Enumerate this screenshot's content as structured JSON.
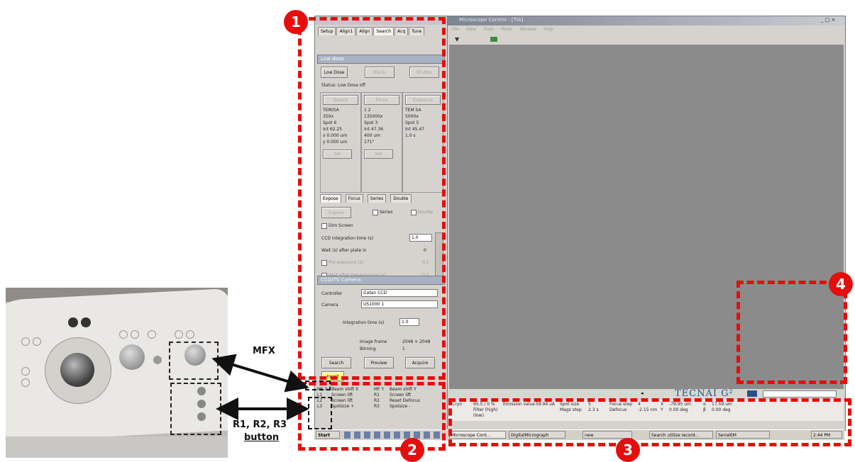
{
  "left_window": {
    "tabs": [
      "Setup",
      "Align1",
      "Align",
      "Search",
      "Acq",
      "Tune"
    ],
    "low_dose_panel": {
      "title": "Low dose",
      "buttons": [
        "Low Dose",
        "Blank",
        "Shutter"
      ],
      "status": "Status: Low Dose off",
      "columns": [
        {
          "label": "Search",
          "lines": [
            "TEM/SA",
            "350x",
            "Spot 6",
            "Int 62.25",
            "x 0.000 um",
            "y 0.000 um"
          ],
          "button": "Set"
        },
        {
          "label": "Focus",
          "lines": [
            "1 2",
            "135000x",
            "Spot 3",
            "Int 47.36",
            "400 um",
            "171°"
          ],
          "button": "Set"
        },
        {
          "label": "Exposure",
          "lines": [
            "TEM SA",
            "5000x",
            "Spot 5",
            "Int 45.47",
            "",
            "1.0 s"
          ],
          "button": ""
        }
      ],
      "tabs2": [
        "Expose",
        "Focus",
        "Series",
        "Double"
      ],
      "expose_button": "Expose",
      "series_label": "Series",
      "double_label": "Double",
      "dim_screen": "Dim Screen",
      "ccd_time_label": "CCD integration time (s)",
      "ccd_time_value": "1.0",
      "wait_label": "Wait (s) after plate in",
      "wait_value": "0",
      "pre_exposure": "Pre-exposure (s)",
      "pre_value": "0.1",
      "wait_after": "Wait after pre-exposure (s)",
      "wait_after_value": "0.1"
    },
    "ccd_panel": {
      "title": "CCD/TV Camera",
      "controller_label": "Controller",
      "controller_value": "Gatan CCD",
      "camera_label": "Camera",
      "camera_value": "US1000 1",
      "integration_label": "Integration time (s)",
      "integration_value": "1.0",
      "image_frame_label": "Image frame",
      "image_frame_value": "2048 × 2048",
      "binning_label": "Binning",
      "binning_value": "1",
      "buttons": [
        "Search",
        "Preview",
        "Acquire"
      ],
      "insert": "Insert"
    },
    "mf_rows": [
      [
        "MF X",
        "Beam shift X",
        "MF Y",
        "Beam shift Y"
      ],
      [
        "L1",
        "Screen lift",
        "R1",
        "Screen lift"
      ],
      [
        "L2",
        "Screen lift",
        "R2",
        "Reset Defocus"
      ],
      [
        "L3",
        "Spotsize +",
        "R3",
        "Spotsize -"
      ]
    ]
  },
  "main_window": {
    "title": "Microscope Control - [TIA]",
    "menu": [
      "File",
      "View",
      "Tools",
      "Mode",
      "Window",
      "Help"
    ],
    "logo": "TECNAI G²",
    "readouts": [
      [
        "Cryo",
        "95.5 / 0 %",
        "Emission value",
        "59.94 uA",
        "Spot size",
        "5",
        "Focus step",
        "4",
        "X",
        "-79.95 um",
        "α",
        "17.59 um"
      ],
      [
        "",
        "Filter (high) (low)",
        "",
        "",
        "Mags step",
        "2.3 s",
        "Defocus",
        "-2.15 nm",
        "Y",
        "0.00 deg",
        "β",
        "0.00 deg"
      ]
    ]
  },
  "taskbar": {
    "start": "Start",
    "items": [
      "Microscope Cont...",
      "DigitalMicrograph",
      "new",
      "Search utilize record...",
      "SerialEM"
    ],
    "clock": "2:44 PM"
  },
  "annotations": {
    "numbers": [
      "1",
      "2",
      "3",
      "4"
    ],
    "mfx_label": "MFX",
    "r_label": "R1, R2, R3",
    "button_label": "button"
  },
  "colors": {
    "annotation_red": "#e60d0d",
    "screen_gray": "#8b8b8b",
    "panel_head": "#a7b3c4"
  }
}
